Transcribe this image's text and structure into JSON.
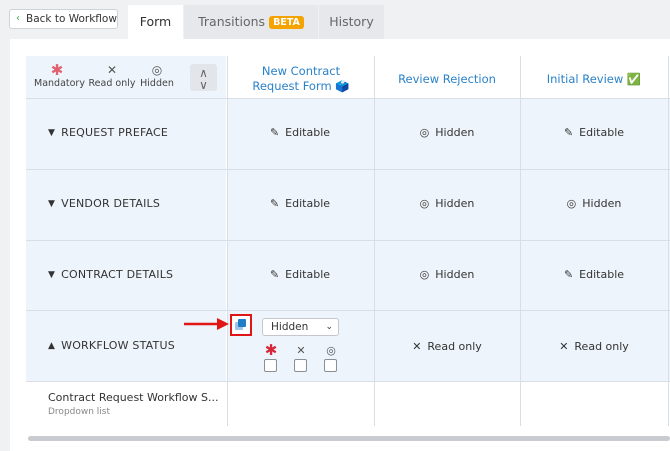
{
  "topbar": {
    "back_label": "Back to Workflow",
    "tabs": [
      {
        "label": "Form"
      },
      {
        "label": "Transitions",
        "badge": "BETA"
      },
      {
        "label": "History"
      }
    ]
  },
  "legend": {
    "mandatory": "Mandatory",
    "read_only": "Read only",
    "hidden": "Hidden"
  },
  "columns": [
    {
      "label": "New Contract Request Form 🗳️"
    },
    {
      "label": "Review Rejection"
    },
    {
      "label": "Initial Review ✅"
    }
  ],
  "sections": [
    {
      "label": "REQUEST PREFACE",
      "cells": [
        "Editable",
        "Hidden",
        "Editable"
      ]
    },
    {
      "label": "VENDOR DETAILS",
      "cells": [
        "Editable",
        "Hidden",
        "Hidden"
      ]
    },
    {
      "label": "CONTRACT DETAILS",
      "cells": [
        "Editable",
        "Hidden",
        "Editable"
      ]
    },
    {
      "label": "WORKFLOW STATUS",
      "cells": [
        "Hidden",
        "Read only",
        "Read only"
      ]
    }
  ],
  "field": {
    "name": "Contract Request Workflow S...",
    "type": "Dropdown list"
  },
  "colors": {
    "accent_blue": "#2a82c9",
    "highlight_red": "#e01515",
    "badge_orange": "#f5a300"
  }
}
